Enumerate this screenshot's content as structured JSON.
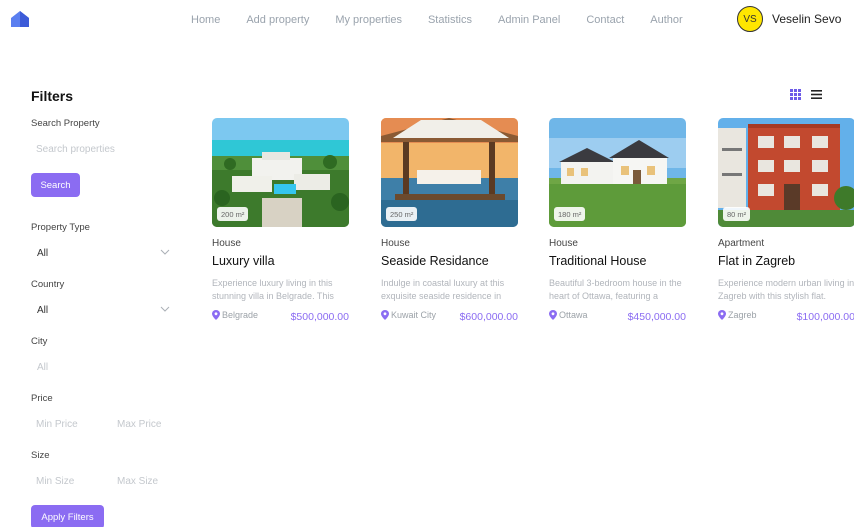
{
  "nav": {
    "links": [
      "Home",
      "Add property",
      "My properties",
      "Statistics",
      "Admin Panel",
      "Contact",
      "Author"
    ],
    "user": {
      "initials": "VS",
      "name": "Veselin Sevo"
    }
  },
  "filters": {
    "title": "Filters",
    "search_label": "Search Property",
    "search_placeholder": "Search properties",
    "search_button": "Search",
    "property_type_label": "Property Type",
    "property_type_value": "All",
    "country_label": "Country",
    "country_value": "All",
    "city_label": "City",
    "city_placeholder": "All",
    "price_label": "Price",
    "min_price_placeholder": "Min Price",
    "max_price_placeholder": "Max Price",
    "size_label": "Size",
    "min_size_placeholder": "Min Size",
    "max_size_placeholder": "Max Size",
    "apply_button": "Apply Filters"
  },
  "colors": {
    "accent": "#8b6cf2",
    "avatar": "#ffe600",
    "muted_text": "#9aa3ad"
  },
  "properties": [
    {
      "size": "200 m²",
      "type": "House",
      "title": "Luxury villa",
      "description": "Experience luxury living in this stunning villa in Belgrade. This",
      "location": "Belgrade",
      "price": "$500,000.00"
    },
    {
      "size": "250 m²",
      "type": "House",
      "title": "Seaside Residance",
      "description": "Indulge in coastal luxury at this exquisite seaside residence in",
      "location": "Kuwait City",
      "price": "$600,000.00"
    },
    {
      "size": "180 m²",
      "type": "House",
      "title": "Traditional House",
      "description": "Beautiful 3-bedroom house in the heart of Ottawa, featuring a",
      "location": "Ottawa",
      "price": "$450,000.00"
    },
    {
      "size": "80 m²",
      "type": "Apartment",
      "title": "Flat in Zagreb",
      "description": "Experience modern urban living in Zagreb with this stylish flat.",
      "location": "Zagreb",
      "price": "$100,000.00"
    }
  ]
}
